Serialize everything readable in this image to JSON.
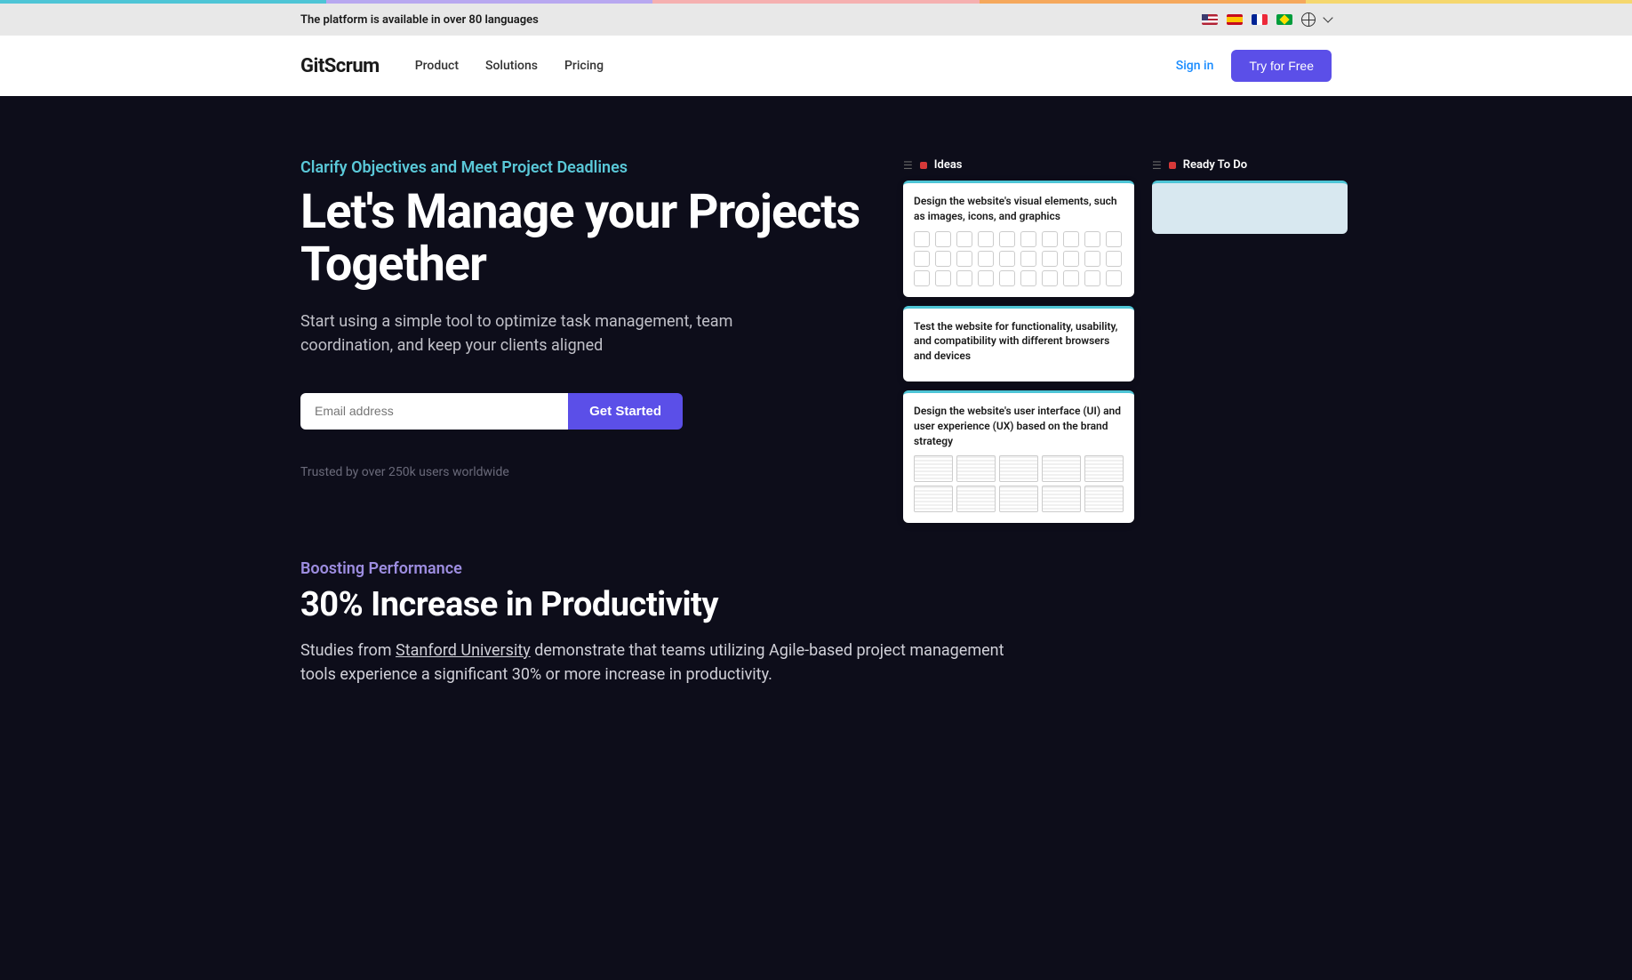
{
  "topbar": {
    "text": "The platform is available in over 80 languages"
  },
  "nav": {
    "logo": "GitScrum",
    "links": [
      "Product",
      "Solutions",
      "Pricing"
    ],
    "signin": "Sign in",
    "try": "Try for Free"
  },
  "hero": {
    "eyebrow": "Clarify Objectives and Meet Project Deadlines",
    "title": "Let's Manage your Projects Together",
    "subtitle": "Start using a simple tool to optimize task management, team coordination, and keep your clients aligned",
    "email_placeholder": "Email address",
    "cta": "Get Started",
    "trusted": "Trusted by over 250k users worldwide"
  },
  "board": {
    "col1": {
      "title": "Ideas",
      "cards": [
        "Design the website's visual elements, such as images, icons, and graphics",
        "Test the website for functionality, usability, and compatibility with different browsers and devices",
        "Design the website's user interface (UI) and user experience (UX) based on the brand strategy"
      ]
    },
    "col2": {
      "title": "Ready To Do"
    }
  },
  "section2": {
    "eyebrow": "Boosting Performance",
    "title": "30% Increase in Productivity",
    "text_before": "Studies from ",
    "link": "Stanford University",
    "text_after": " demonstrate that teams utilizing Agile-based project management tools experience a significant 30% or more increase in productivity."
  }
}
